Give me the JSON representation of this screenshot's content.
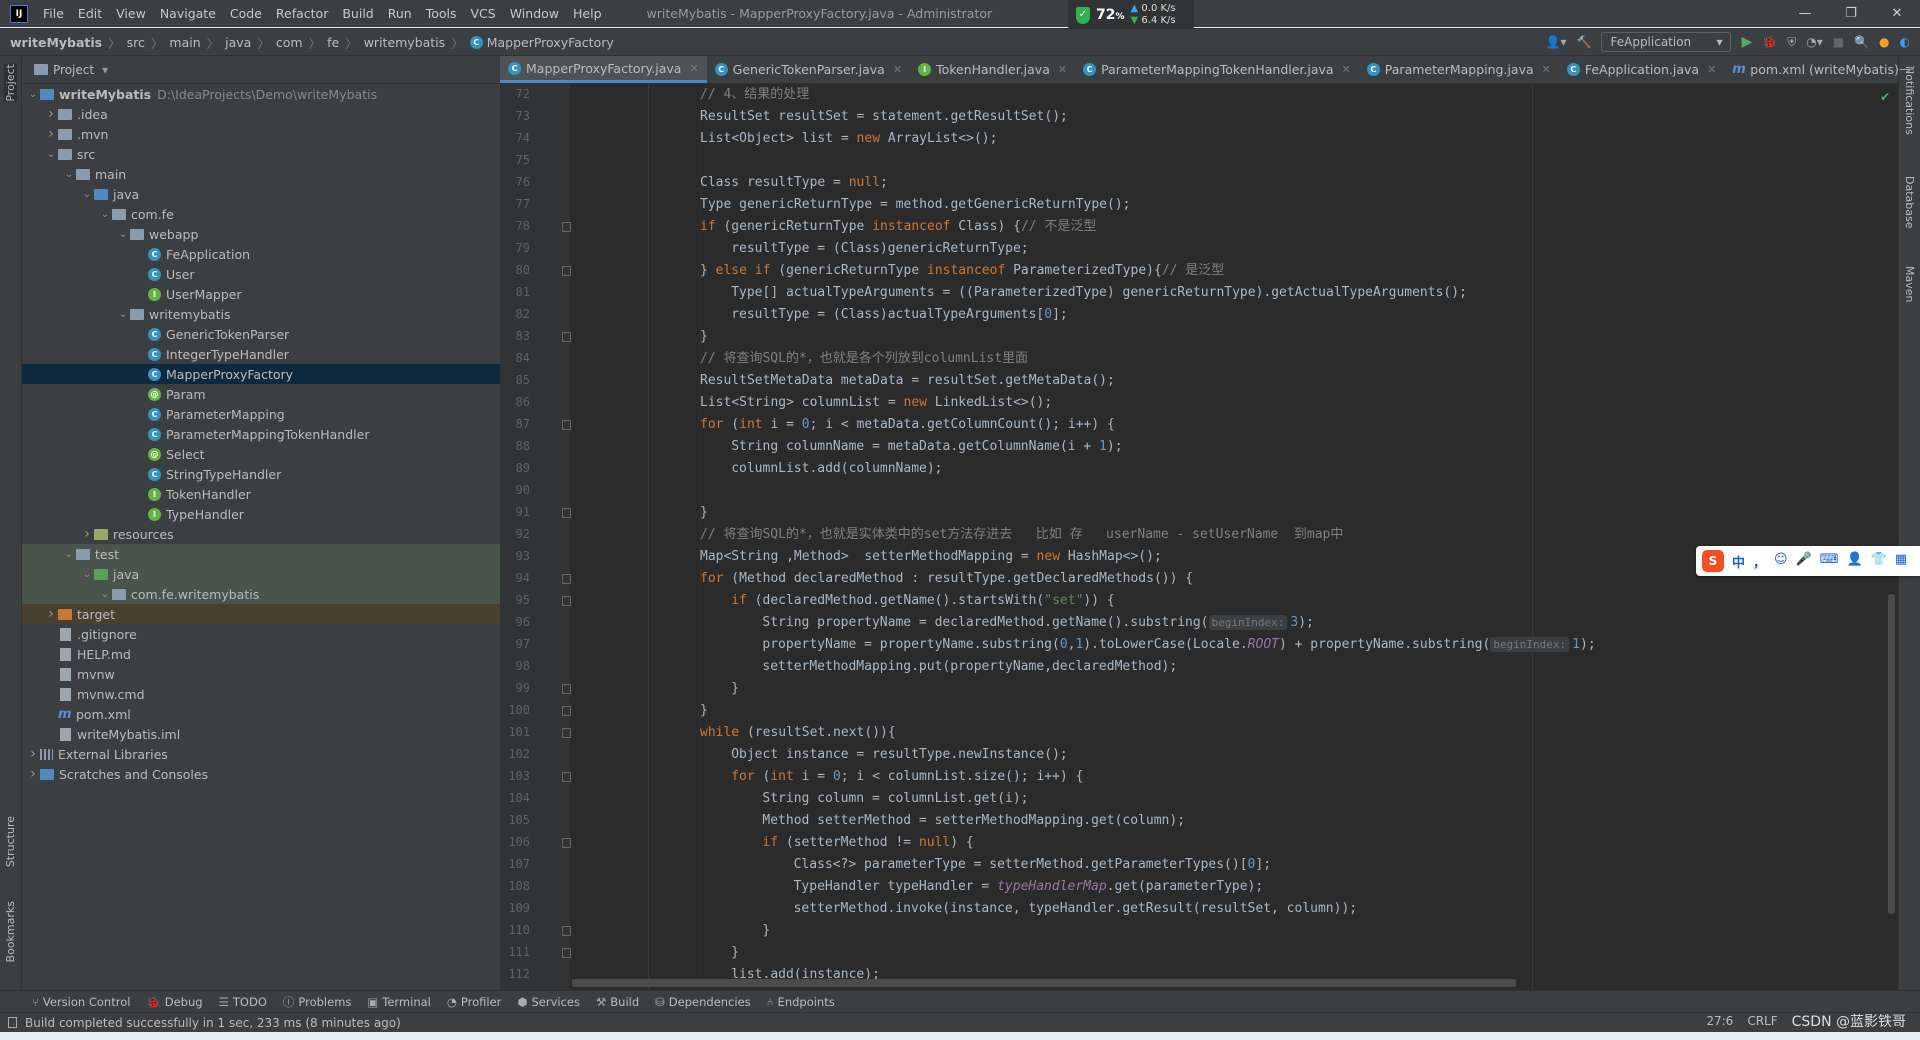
{
  "titlebar": {
    "app_icon": "IJ",
    "menu": [
      "File",
      "Edit",
      "View",
      "Navigate",
      "Code",
      "Refactor",
      "Build",
      "Run",
      "Tools",
      "VCS",
      "Window",
      "Help"
    ],
    "title": "writeMybatis - MapperProxyFactory.java - Administrator",
    "window_controls": [
      "—",
      "❐",
      "✕"
    ]
  },
  "netwidget": {
    "percent": "72",
    "unit": "%",
    "up": "0.0 K/s",
    "down": "6.4 K/s",
    "color": "#2fb350"
  },
  "navbar": {
    "breadcrumb": [
      "writeMybatis",
      "src",
      "main",
      "java",
      "com",
      "fe",
      "writemybatis",
      "MapperProxyFactory"
    ],
    "run_config": "FeApplication"
  },
  "left_stripe": [
    "Project",
    "Structure",
    "Bookmarks"
  ],
  "right_stripe": [
    "Notifications",
    "Database",
    "Maven"
  ],
  "project": {
    "title": "Project",
    "tree": [
      {
        "label": "writeMybatis",
        "path": "D:\\IdeaProjects\\Demo\\writeMybatis",
        "d": 0,
        "icon": "module-folder",
        "exp": "open",
        "bold": true
      },
      {
        "label": ".idea",
        "d": 1,
        "icon": "folder",
        "exp": "closed"
      },
      {
        "label": ".mvn",
        "d": 1,
        "icon": "folder",
        "exp": "closed"
      },
      {
        "label": "src",
        "d": 1,
        "icon": "folder",
        "exp": "open"
      },
      {
        "label": "main",
        "d": 2,
        "icon": "folder",
        "exp": "open"
      },
      {
        "label": "java",
        "d": 3,
        "icon": "source-folder",
        "exp": "open"
      },
      {
        "label": "com.fe",
        "d": 4,
        "icon": "package",
        "exp": "open"
      },
      {
        "label": "webapp",
        "d": 5,
        "icon": "package",
        "exp": "open"
      },
      {
        "label": "FeApplication",
        "d": 6,
        "icon": "class"
      },
      {
        "label": "User",
        "d": 6,
        "icon": "class"
      },
      {
        "label": "UserMapper",
        "d": 6,
        "icon": "interface"
      },
      {
        "label": "writemybatis",
        "d": 5,
        "icon": "package",
        "exp": "open"
      },
      {
        "label": "GenericTokenParser",
        "d": 6,
        "icon": "class"
      },
      {
        "label": "IntegerTypeHandler",
        "d": 6,
        "icon": "class"
      },
      {
        "label": "MapperProxyFactory",
        "d": 6,
        "icon": "class",
        "selected": true
      },
      {
        "label": "Param",
        "d": 6,
        "icon": "annotation"
      },
      {
        "label": "ParameterMapping",
        "d": 6,
        "icon": "class"
      },
      {
        "label": "ParameterMappingTokenHandler",
        "d": 6,
        "icon": "class"
      },
      {
        "label": "Select",
        "d": 6,
        "icon": "annotation"
      },
      {
        "label": "StringTypeHandler",
        "d": 6,
        "icon": "class"
      },
      {
        "label": "TokenHandler",
        "d": 6,
        "icon": "interface"
      },
      {
        "label": "TypeHandler",
        "d": 6,
        "icon": "interface"
      },
      {
        "label": "resources",
        "d": 3,
        "icon": "resources-folder",
        "exp": "closed"
      },
      {
        "label": "test",
        "d": 2,
        "icon": "folder",
        "exp": "open",
        "test": true
      },
      {
        "label": "java",
        "d": 3,
        "icon": "test-folder",
        "exp": "open",
        "test": true
      },
      {
        "label": "com.fe.writemybatis",
        "d": 4,
        "icon": "package",
        "exp": "open",
        "test": true
      },
      {
        "label": "target",
        "d": 1,
        "icon": "excluded-folder",
        "exp": "closed",
        "excluded": true
      },
      {
        "label": ".gitignore",
        "d": 1,
        "icon": "file"
      },
      {
        "label": "HELP.md",
        "d": 1,
        "icon": "file"
      },
      {
        "label": "mvnw",
        "d": 1,
        "icon": "file"
      },
      {
        "label": "mvnw.cmd",
        "d": 1,
        "icon": "file"
      },
      {
        "label": "pom.xml",
        "d": 1,
        "icon": "maven"
      },
      {
        "label": "writeMybatis.iml",
        "d": 1,
        "icon": "file"
      },
      {
        "label": "External Libraries",
        "d": 0,
        "icon": "libraries",
        "exp": "closed"
      },
      {
        "label": "Scratches and Consoles",
        "d": 0,
        "icon": "scratches",
        "exp": "closed"
      }
    ]
  },
  "tabs": [
    {
      "label": "MapperProxyFactory.java",
      "icon": "class",
      "active": true
    },
    {
      "label": "GenericTokenParser.java",
      "icon": "class"
    },
    {
      "label": "TokenHandler.java",
      "icon": "interface"
    },
    {
      "label": "ParameterMappingTokenHandler.java",
      "icon": "class"
    },
    {
      "label": "ParameterMapping.java",
      "icon": "class"
    },
    {
      "label": "FeApplication.java",
      "icon": "class"
    },
    {
      "label": "pom.xml (writeMybatis)",
      "icon": "maven"
    }
  ],
  "editor": {
    "first_line": 72,
    "fold_lines": [
      78,
      80,
      83,
      87,
      91,
      94,
      95,
      99,
      100,
      101,
      103,
      106,
      110,
      111
    ],
    "lines": [
      [
        [
          0,
          [
            [
              "// 4、结果的处理",
              "cm"
            ]
          ]
        ]
      ],
      [
        [
          0,
          [
            [
              "ResultSet resultSet = statement.getResultSet();",
              ""
            ]
          ]
        ]
      ],
      [
        [
          0,
          [
            [
              "List<Object> list = ",
              ""
            ],
            [
              "new",
              "kw"
            ],
            [
              " ArrayList<>();",
              ""
            ]
          ]
        ]
      ],
      [
        [
          0,
          []
        ]
      ],
      [
        [
          0,
          [
            [
              "Class resultType = ",
              ""
            ],
            [
              "null",
              "kw"
            ],
            [
              ";",
              ""
            ]
          ]
        ]
      ],
      [
        [
          0,
          [
            [
              "Type genericReturnType = method.getGenericReturnType();",
              ""
            ]
          ]
        ]
      ],
      [
        [
          0,
          [
            [
              "if",
              "kw"
            ],
            [
              " (genericReturnType ",
              ""
            ],
            [
              "instanceof",
              "kw"
            ],
            [
              " Class) {",
              ""
            ],
            [
              "// 不是泛型",
              "cm"
            ]
          ]
        ]
      ],
      [
        [
          4,
          [
            [
              "resultType = (Class)genericReturnType;",
              ""
            ]
          ]
        ]
      ],
      [
        [
          0,
          [
            [
              "} ",
              ""
            ],
            [
              "else if",
              "kw"
            ],
            [
              " (genericReturnType ",
              ""
            ],
            [
              "instanceof",
              "kw"
            ],
            [
              " ParameterizedType){",
              ""
            ],
            [
              "// 是泛型",
              "cm"
            ]
          ]
        ]
      ],
      [
        [
          4,
          [
            [
              "Type[] actualTypeArguments = ((ParameterizedType) genericReturnType).getActualTypeArguments();",
              ""
            ]
          ]
        ]
      ],
      [
        [
          4,
          [
            [
              "resultType = (Class)actualTypeArguments[",
              ""
            ],
            [
              "0",
              "num"
            ],
            [
              "];",
              ""
            ]
          ]
        ]
      ],
      [
        [
          0,
          [
            [
              "}",
              ""
            ]
          ]
        ]
      ],
      [
        [
          0,
          [
            [
              "// 将查询SQL的*，也就是各个列放到columnList里面",
              "cm"
            ]
          ]
        ]
      ],
      [
        [
          0,
          [
            [
              "ResultSetMetaData metaData = resultSet.getMetaData();",
              ""
            ]
          ]
        ]
      ],
      [
        [
          0,
          [
            [
              "List<String> columnList = ",
              ""
            ],
            [
              "new",
              "kw"
            ],
            [
              " LinkedList<>();",
              ""
            ]
          ]
        ]
      ],
      [
        [
          0,
          [
            [
              "for",
              "kw"
            ],
            [
              " (",
              ""
            ],
            [
              "int",
              "kw"
            ],
            [
              " i = ",
              ""
            ],
            [
              "0",
              "num"
            ],
            [
              "; i < metaData.getColumnCount(); i++) {",
              ""
            ]
          ]
        ]
      ],
      [
        [
          4,
          [
            [
              "String columnName = metaData.getColumnName(i + ",
              ""
            ],
            [
              "1",
              "num"
            ],
            [
              ");",
              ""
            ]
          ]
        ]
      ],
      [
        [
          4,
          [
            [
              "columnList.add(columnName);",
              ""
            ]
          ]
        ]
      ],
      [
        [
          0,
          []
        ]
      ],
      [
        [
          0,
          [
            [
              "}",
              ""
            ]
          ]
        ]
      ],
      [
        [
          0,
          [
            [
              "// 将查询SQL的*，也就是实体类中的set方法存进去   比如 存   userName - setUserName  到map中",
              "cm"
            ]
          ]
        ]
      ],
      [
        [
          0,
          [
            [
              "Map<String ,Method>  setterMethodMapping = ",
              ""
            ],
            [
              "new",
              "kw"
            ],
            [
              " HashMap<>();",
              ""
            ]
          ]
        ]
      ],
      [
        [
          0,
          [
            [
              "for",
              "kw"
            ],
            [
              " (Method declaredMethod : resultType.getDeclaredMethods()) {",
              ""
            ]
          ]
        ]
      ],
      [
        [
          4,
          [
            [
              "if",
              "kw"
            ],
            [
              " (declaredMethod.getName().startsWith(",
              ""
            ],
            [
              "\"set\"",
              "str"
            ],
            [
              ")) {",
              ""
            ]
          ]
        ]
      ],
      [
        [
          8,
          [
            [
              "String propertyName = declaredMethod.getName().substring(",
              ""
            ],
            [
              "beginIndex:",
              "hint"
            ],
            [
              "3",
              "num"
            ],
            [
              ");",
              ""
            ]
          ]
        ]
      ],
      [
        [
          8,
          [
            [
              "propertyName = propertyName.substring(",
              ""
            ],
            [
              "0",
              "num"
            ],
            [
              ",",
              ""
            ],
            [
              "1",
              "num"
            ],
            [
              ").toLowerCase(Locale.",
              ""
            ],
            [
              "ROOT",
              "st"
            ],
            [
              ") + propertyName.substring(",
              ""
            ],
            [
              "beginIndex:",
              "hint"
            ],
            [
              "1",
              "num"
            ],
            [
              ");",
              ""
            ]
          ]
        ]
      ],
      [
        [
          8,
          [
            [
              "setterMethodMapping.put(propertyName,declaredMethod);",
              ""
            ]
          ]
        ]
      ],
      [
        [
          4,
          [
            [
              "}",
              ""
            ]
          ]
        ]
      ],
      [
        [
          0,
          [
            [
              "}",
              ""
            ]
          ]
        ]
      ],
      [
        [
          0,
          [
            [
              "while",
              "kw"
            ],
            [
              " (resultSet.next()){",
              ""
            ]
          ]
        ]
      ],
      [
        [
          4,
          [
            [
              "Object instance = resultType.newInstance();",
              ""
            ]
          ]
        ]
      ],
      [
        [
          4,
          [
            [
              "for",
              "kw"
            ],
            [
              " (",
              ""
            ],
            [
              "int",
              "kw"
            ],
            [
              " i = ",
              ""
            ],
            [
              "0",
              "num"
            ],
            [
              "; i < columnList.size(); i++) {",
              ""
            ]
          ]
        ]
      ],
      [
        [
          8,
          [
            [
              "String column = columnList.get(i);",
              ""
            ]
          ]
        ]
      ],
      [
        [
          8,
          [
            [
              "Method setterMethod = setterMethodMapping.get(column);",
              ""
            ]
          ]
        ]
      ],
      [
        [
          8,
          [
            [
              "if",
              "kw"
            ],
            [
              " (setterMethod != ",
              ""
            ],
            [
              "null",
              "kw"
            ],
            [
              ") {",
              ""
            ]
          ]
        ]
      ],
      [
        [
          12,
          [
            [
              "Class<?> parameterType = setterMethod.getParameterTypes()[",
              ""
            ],
            [
              "0",
              "num"
            ],
            [
              "];",
              ""
            ]
          ]
        ]
      ],
      [
        [
          12,
          [
            [
              "TypeHandler typeHandler = ",
              ""
            ],
            [
              "typeHandlerMap",
              "st"
            ],
            [
              ".get(parameterType);",
              ""
            ]
          ]
        ]
      ],
      [
        [
          12,
          [
            [
              "setterMethod.invoke(instance, typeHandler.getResult(resultSet, column));",
              ""
            ]
          ]
        ]
      ],
      [
        [
          8,
          [
            [
              "}",
              ""
            ]
          ]
        ]
      ],
      [
        [
          4,
          [
            [
              "}",
              ""
            ]
          ]
        ]
      ],
      [
        [
          4,
          [
            [
              "list.add(instance);",
              ""
            ]
          ]
        ]
      ]
    ]
  },
  "bottom_tabs": [
    "Version Control",
    "Debug",
    "TODO",
    "Problems",
    "Terminal",
    "Profiler",
    "Services",
    "Build",
    "Dependencies",
    "Endpoints"
  ],
  "status": {
    "message": "Build completed successfully in 1 sec, 233 ms (8 minutes ago)",
    "position": "27:6",
    "line_sep": "CRLF",
    "watermark": "CSDN @蓝影铁哥"
  },
  "ime": {
    "logo": "S",
    "mode": "中",
    "icons": [
      "，",
      "☺",
      "🎤",
      "⌨",
      "👤",
      "👕",
      "▦"
    ]
  },
  "colors": {
    "accent": "#4a88c7",
    "selection": "#0d293e",
    "keyword": "#cc7832",
    "comment": "#808080",
    "number": "#6897bb",
    "string": "#6a8759"
  }
}
